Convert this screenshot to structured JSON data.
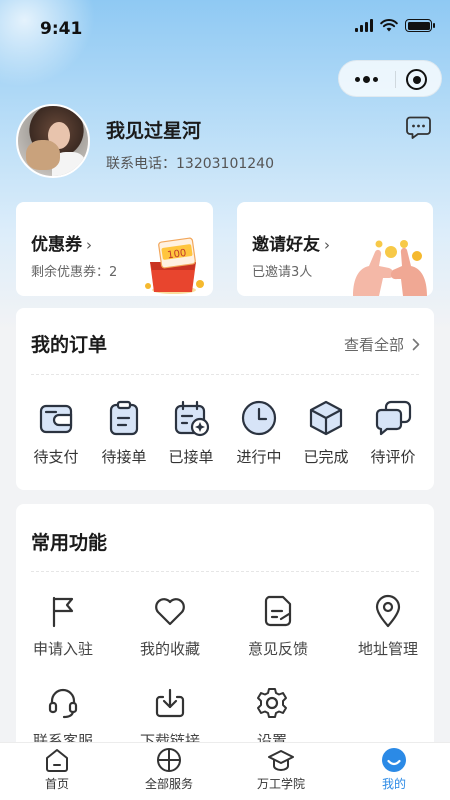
{
  "status_bar": {
    "time": "9:41"
  },
  "user": {
    "name": "我见过星河",
    "phone_label": "联系电话：",
    "phone": "13203101240"
  },
  "promos": [
    {
      "title": "优惠券",
      "sub_label": "剩余优惠券：",
      "sub_value": "2",
      "ticket_text": "100"
    },
    {
      "title": "邀请好友",
      "sub_label": "已邀请",
      "sub_value": "3人"
    }
  ],
  "orders": {
    "title": "我的订单",
    "view_all": "查看全部",
    "items": [
      {
        "label": "待支付",
        "icon": "wallet-icon"
      },
      {
        "label": "待接单",
        "icon": "clipboard-icon"
      },
      {
        "label": "已接单",
        "icon": "calendar-check-icon"
      },
      {
        "label": "进行中",
        "icon": "clock-icon"
      },
      {
        "label": "已完成",
        "icon": "box-icon"
      },
      {
        "label": "待评价",
        "icon": "chat-icon"
      }
    ]
  },
  "functions": {
    "title": "常用功能",
    "items": [
      {
        "label": "申请入驻",
        "icon": "flag-icon"
      },
      {
        "label": "我的收藏",
        "icon": "heart-icon"
      },
      {
        "label": "意见反馈",
        "icon": "document-edit-icon"
      },
      {
        "label": "地址管理",
        "icon": "location-icon"
      },
      {
        "label": "联系客服",
        "icon": "headset-icon"
      },
      {
        "label": "下载链接",
        "icon": "download-icon"
      },
      {
        "label": "设置",
        "icon": "gear-icon"
      }
    ]
  },
  "tabbar": {
    "accent_color": "#2b8ae6",
    "tabs": [
      {
        "label": "首页",
        "icon": "home-icon"
      },
      {
        "label": "全部服务",
        "icon": "grid-icon"
      },
      {
        "label": "万工学院",
        "icon": "graduation-cap-icon"
      },
      {
        "label": "我的",
        "icon": "profile-smile-icon",
        "active": true
      }
    ]
  }
}
